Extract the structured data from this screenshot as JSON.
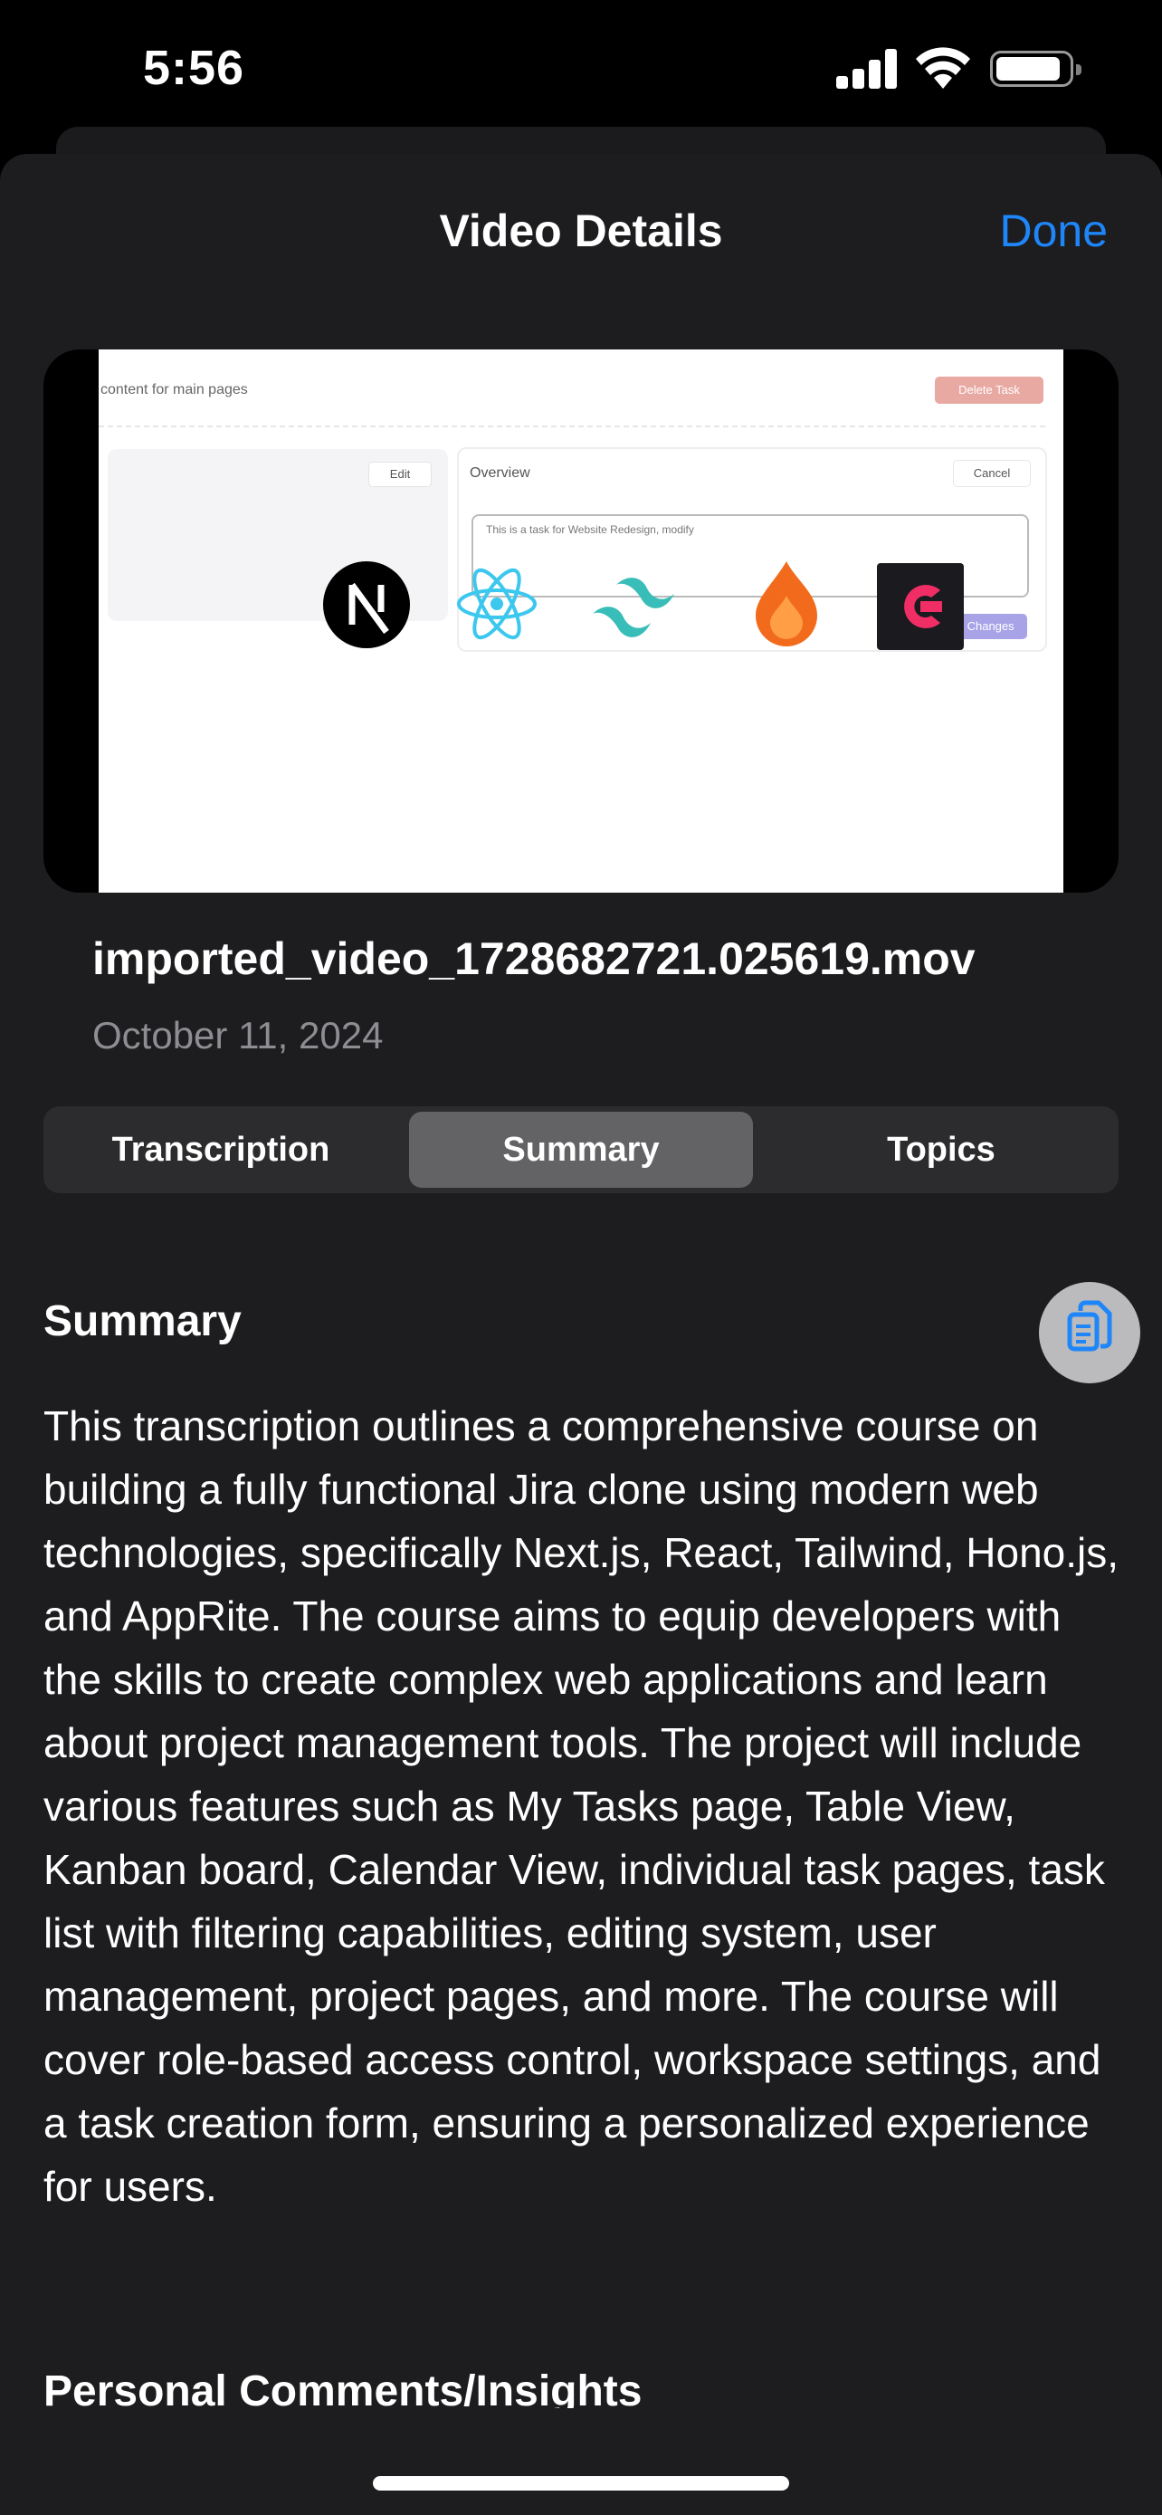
{
  "status_bar": {
    "time": "5:56"
  },
  "nav": {
    "title": "Video Details",
    "done_label": "Done"
  },
  "video": {
    "thumbnail": {
      "breadcrumb": "content for main pages",
      "delete_task": "Delete Task",
      "edit": "Edit",
      "overview": "Overview",
      "cancel": "Cancel",
      "textarea_text": "This is a task for Website Redesign, modify",
      "save_changes": "Save Changes",
      "logos": [
        "nextjs-logo",
        "react-logo",
        "tailwind-logo",
        "hono-logo",
        "appwrite-logo"
      ]
    },
    "file_name": "imported_video_1728682721.025619.mov",
    "date": "October 11, 2024"
  },
  "tabs": [
    {
      "label": "Transcription",
      "active": false
    },
    {
      "label": "Summary",
      "active": true
    },
    {
      "label": "Topics",
      "active": false
    }
  ],
  "summary": {
    "heading": "Summary",
    "copy_icon": "copy-icon",
    "text": "This transcription outlines a comprehensive course on building a fully functional Jira clone using modern web technologies, specifically Next.js, React, Tailwind, Hono.js, and AppRite. The course aims to equip developers with the skills to create complex web applications and learn about project management tools. The project will include various features such as My Tasks page, Table View, Kanban board, Calendar View, individual task pages, task list with filtering capabilities, editing system, user management, project pages, and more. The course will cover role-based access control, workspace settings, and a task creation form, ensuring a personalized experience for users."
  },
  "next_section": {
    "heading": "Personal Comments/Insights"
  },
  "colors": {
    "accent": "#1e86f8",
    "background": "#1d1d1f",
    "segment_bg": "#2c2c2e",
    "segment_active": "#636366",
    "secondary_text": "#8d8d92"
  }
}
